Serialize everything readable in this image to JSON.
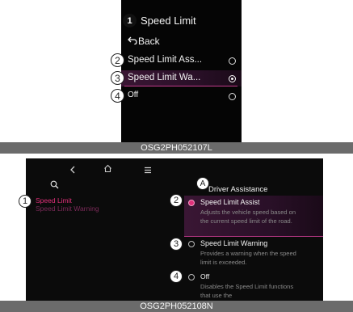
{
  "top_panel": {
    "title": "Speed Limit",
    "title_marker": "1",
    "back_icon": "back-arrow-icon",
    "back_label": "Back",
    "items": [
      {
        "marker": "2",
        "label": "Speed Limit Ass...",
        "selected": false
      },
      {
        "marker": "3",
        "label": "Speed Limit Wa...",
        "selected": true
      },
      {
        "marker": "4",
        "label": "Off",
        "selected": false
      }
    ],
    "caption": "OSG2PH052107L"
  },
  "bottom_panel": {
    "toolbar_icons": [
      "back-chevron-icon",
      "home-icon",
      "menu-icon"
    ],
    "search_icon": "search-icon",
    "header_marker": "A",
    "header_title": "Driver Assistance",
    "left_marker": "1",
    "left_items": [
      {
        "label": "Speed Limit",
        "active": true
      },
      {
        "label": "Speed Limit Warning",
        "active": false
      }
    ],
    "options": [
      {
        "marker": "2",
        "label": "Speed Limit Assist",
        "selected": true,
        "desc": "Adjusts the vehicle speed based on the current speed limit of the road."
      },
      {
        "marker": "3",
        "label": "Speed Limit Warning",
        "selected": false,
        "desc": "Provides a warning when the speed limit is exceeded."
      },
      {
        "marker": "4",
        "label": "Off",
        "selected": false,
        "desc": "Disables the Speed Limit functions that use the"
      }
    ],
    "caption": "OSG2PH052108N"
  },
  "colors": {
    "accent": "#e0307a",
    "selected_bg": "#3a1634"
  }
}
